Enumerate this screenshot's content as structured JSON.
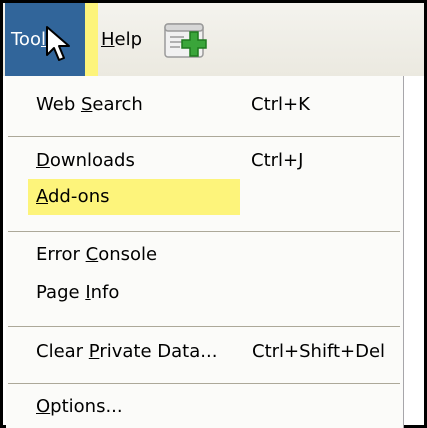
{
  "menubar": {
    "tools": {
      "pre": "Too",
      "ul": "l",
      "post": "s"
    },
    "help": {
      "ul": "H",
      "post": "elp"
    }
  },
  "menu": {
    "web_search": {
      "pre": "Web ",
      "ul": "S",
      "post": "earch",
      "shortcut": "Ctrl+K"
    },
    "downloads": {
      "pre": "",
      "ul": "D",
      "post": "ownloads",
      "shortcut": "Ctrl+J"
    },
    "addons": {
      "pre": "",
      "ul": "A",
      "post": "dd-ons"
    },
    "error_console": {
      "pre": "Error ",
      "ul": "C",
      "post": "onsole"
    },
    "page_info": {
      "pre": "Page ",
      "ul": "I",
      "post": "nfo"
    },
    "clear_private_data": {
      "pre": "Clear ",
      "ul": "P",
      "post": "rivate Data...",
      "shortcut": "Ctrl+Shift+Del"
    },
    "options": {
      "pre": "",
      "ul": "O",
      "post": "ptions..."
    }
  },
  "colors": {
    "active_menu_bg": "#31659a",
    "highlight": "#fdf47b",
    "addon_icon_plus": "#3aa53a"
  },
  "icons": {
    "cursor": "arrow-pointer",
    "toolbar_addon": "document-with-green-plus"
  }
}
